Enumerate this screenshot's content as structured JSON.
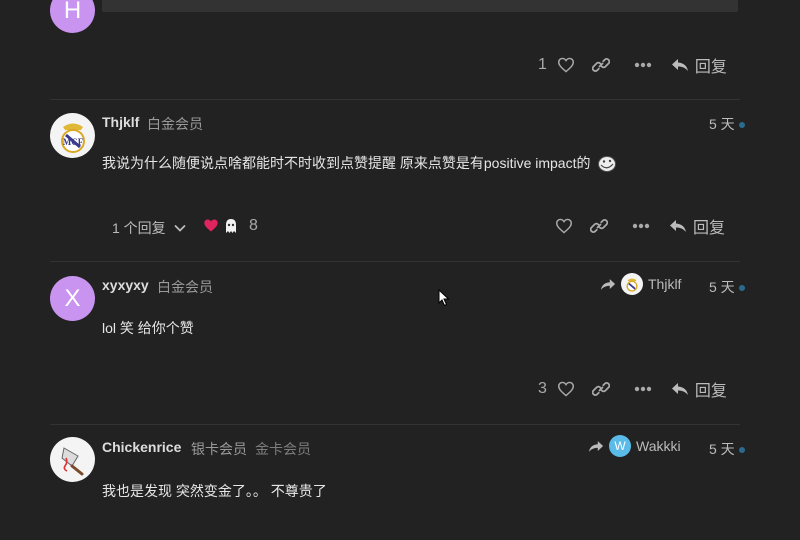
{
  "posts": [
    {
      "avatar_letter": "H",
      "like_count": "1",
      "reply_label": "回复"
    },
    {
      "username": "Thjklf",
      "user_title": "白金会员",
      "date": "5 天",
      "body": "我说为什么随便说点啥都能时不时收到点赞提醒 原来点赞是有positive impact的",
      "replies_label": "1 个回复",
      "reaction_count": "8",
      "reply_label": "回复"
    },
    {
      "avatar_letter": "X",
      "username": "xyxyxy",
      "user_title": "白金会员",
      "reply_to": "Thjklf",
      "date": "5 天",
      "body": "lol 笑 给你个赞",
      "like_count": "3",
      "reply_label": "回复"
    },
    {
      "username": "Chickenrice",
      "user_title": "银卡会员",
      "user_title2": "金卡会员",
      "reply_to": "Wakkki",
      "reply_to_letter": "W",
      "date": "5 天",
      "body": "我也是发现 突然变金了。。 不尊贵了"
    }
  ],
  "colors": {
    "background": "#222222",
    "letter_avatar": "#c894f0",
    "wakkki_avatar": "#5bbbe8",
    "heart_red": "#e0245e"
  }
}
